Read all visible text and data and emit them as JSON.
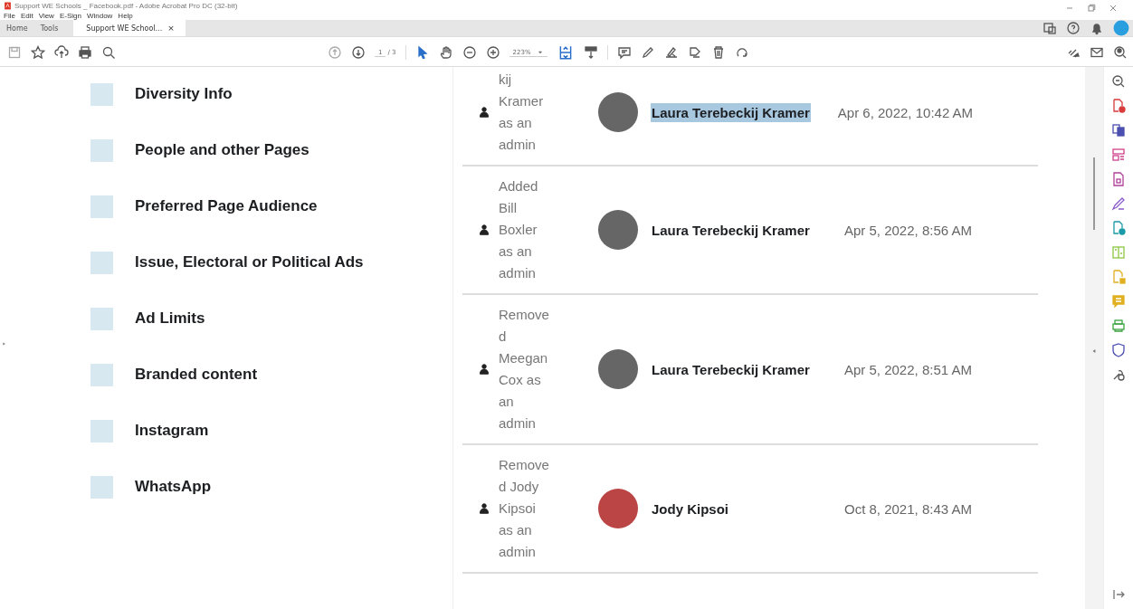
{
  "window": {
    "title": "Support WE Schools _ Facebook.pdf - Adobe Acrobat Pro DC (32-bit)"
  },
  "menu": [
    "File",
    "Edit",
    "View",
    "E-Sign",
    "Window",
    "Help"
  ],
  "tabs": [
    {
      "label": "Home",
      "kind": "nav",
      "selected": false
    },
    {
      "label": "Tools",
      "kind": "nav",
      "selected": false
    },
    {
      "label": "Support WE School...",
      "kind": "document",
      "selected": true,
      "close": "×"
    }
  ],
  "toolbar": {
    "page": "1",
    "page_total": "/ 3",
    "zoom": "223%"
  },
  "settings_list": [
    {
      "label": "Diversity Info"
    },
    {
      "label": "People and other Pages"
    },
    {
      "label": "Preferred Page Audience"
    },
    {
      "label": "Issue, Electoral or Political Ads"
    },
    {
      "label": "Ad Limits"
    },
    {
      "label": "Branded content"
    },
    {
      "label": "Instagram"
    },
    {
      "label": "WhatsApp"
    }
  ],
  "activity": [
    {
      "description": "kij\nKramer\nas an\nadmin",
      "person": "Laura Terebeckij Kramer",
      "highlighted": true,
      "time": "Apr 6, 2022, 10:42 AM"
    },
    {
      "description": "Added\nBill\nBoxler\nas an\nadmin",
      "person": "Laura Terebeckij Kramer",
      "highlighted": false,
      "time": "Apr 5, 2022, 8:56 AM"
    },
    {
      "description": "Remove\nd\nMeegan\nCox as\nan\nadmin",
      "person": "Laura Terebeckij Kramer",
      "highlighted": false,
      "time": "Apr 5, 2022, 8:51 AM"
    },
    {
      "description": "Remove\nd Jody\nKipsoi\nas an\nadmin",
      "person": "Jody Kipsoi",
      "highlighted": false,
      "time": "Oct 8, 2021, 8:43 AM"
    }
  ]
}
